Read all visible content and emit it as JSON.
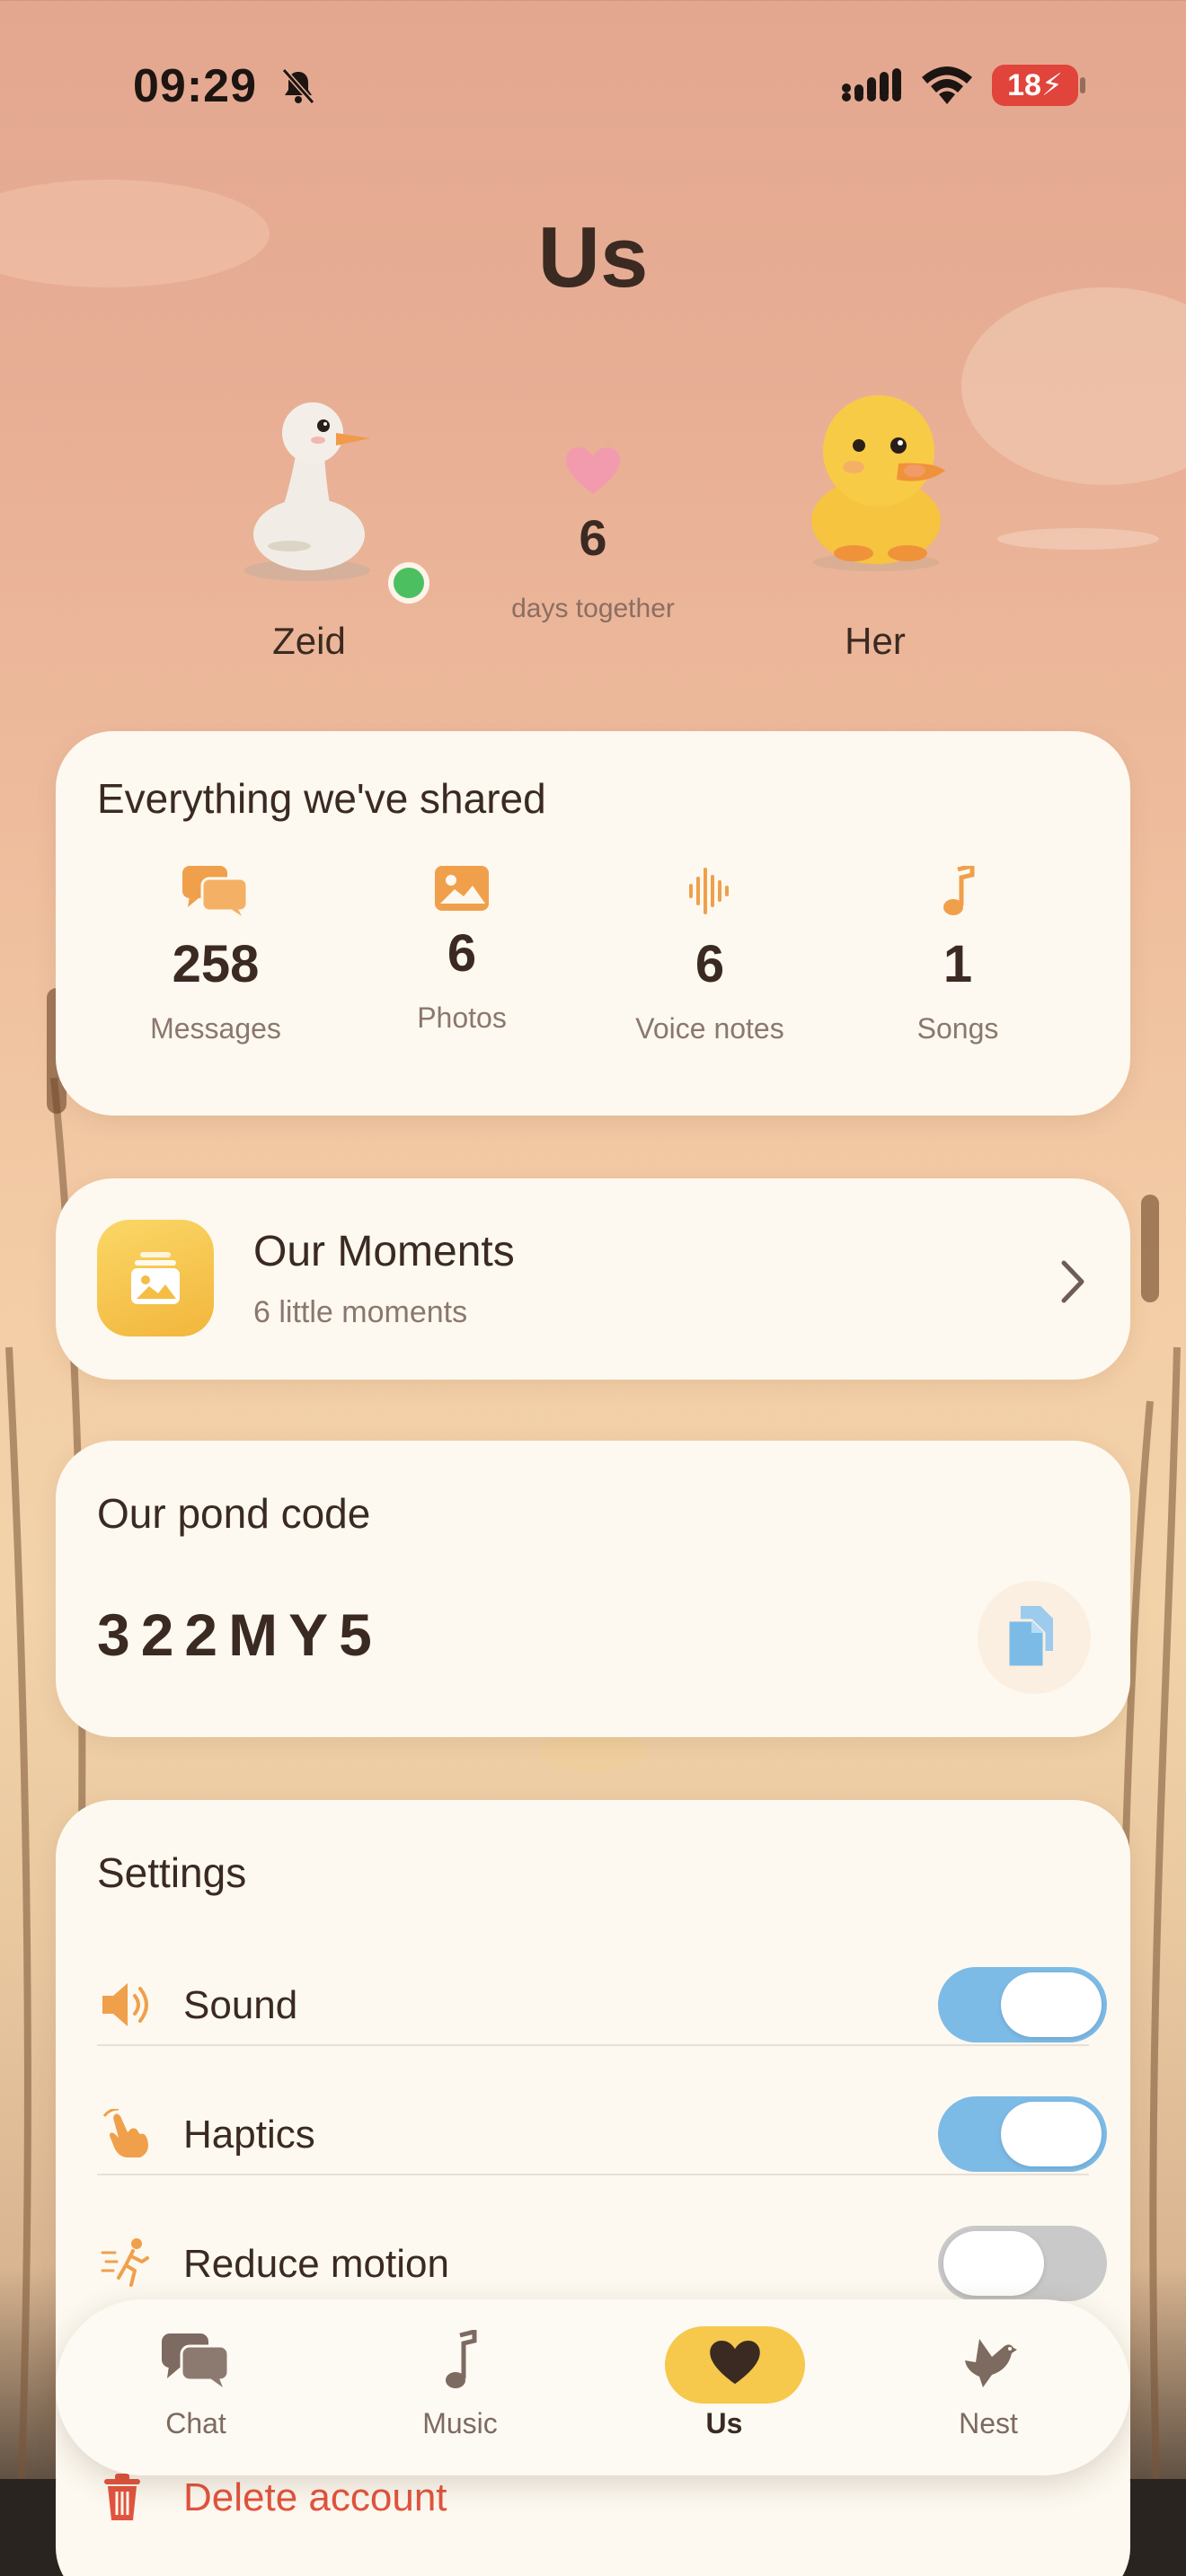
{
  "status_bar": {
    "time": "09:29",
    "battery": "18"
  },
  "page": {
    "title": "Us"
  },
  "couple": {
    "left_name": "Zeid",
    "right_name": "Her",
    "days_count": "6",
    "days_label": "days together"
  },
  "stats": {
    "title": "Everything we've shared",
    "items": [
      {
        "icon": "messages-icon",
        "value": "258",
        "label": "Messages"
      },
      {
        "icon": "photo-icon",
        "value": "6",
        "label": "Photos"
      },
      {
        "icon": "waveform-icon",
        "value": "6",
        "label": "Voice notes"
      },
      {
        "icon": "music-note-icon",
        "value": "1",
        "label": "Songs"
      }
    ]
  },
  "moments": {
    "title": "Our Moments",
    "subtitle": "6 little moments"
  },
  "pond": {
    "title": "Our pond code",
    "code": "322MY5"
  },
  "settings": {
    "title": "Settings",
    "rows": [
      {
        "label": "Sound",
        "on": true
      },
      {
        "label": "Haptics",
        "on": true
      },
      {
        "label": "Reduce motion",
        "on": false
      }
    ],
    "delete_label": "Delete account"
  },
  "tabs": [
    {
      "label": "Chat",
      "icon": "chat-icon"
    },
    {
      "label": "Music",
      "icon": "music-note-icon"
    },
    {
      "label": "Us",
      "icon": "heart-icon",
      "active": true
    },
    {
      "label": "Nest",
      "icon": "bird-icon"
    }
  ],
  "colors": {
    "accent_orange": "#f0a04b",
    "toggle_on": "#7dbbe7",
    "active_tab": "#f6c84c",
    "danger": "#e2543f",
    "online": "#4cc061"
  }
}
